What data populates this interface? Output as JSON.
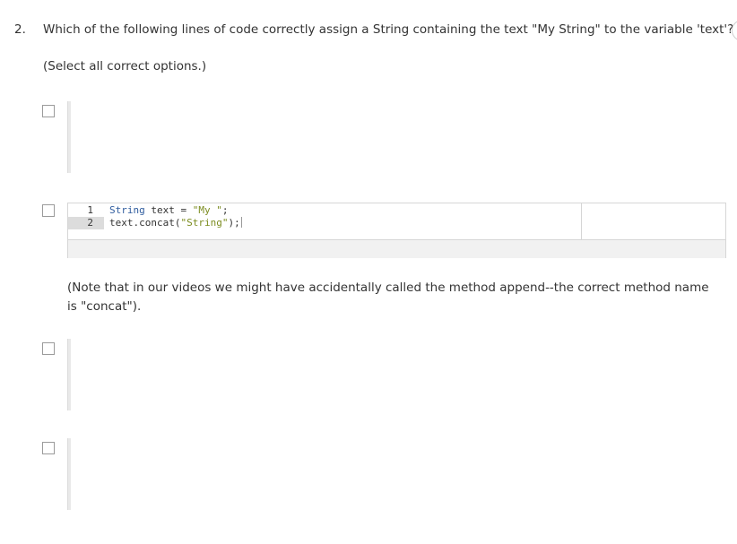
{
  "question": {
    "number": "2.",
    "text": "Which of the following lines of code correctly assign a String containing the text \"My String\" to the variable 'text'?",
    "instruction": "(Select all correct options.)"
  },
  "options": [
    {
      "checked": false
    },
    {
      "checked": false,
      "code_lines": [
        {
          "number": "1",
          "tokens": [
            {
              "type": "kw",
              "text": "String"
            },
            {
              "type": "plain",
              "text": " text "
            },
            {
              "type": "op",
              "text": "="
            },
            {
              "type": "plain",
              "text": " "
            },
            {
              "type": "str",
              "text": "\"My \""
            },
            {
              "type": "plain",
              "text": ";"
            }
          ]
        },
        {
          "number": "2",
          "tokens": [
            {
              "type": "plain",
              "text": "text.concat("
            },
            {
              "type": "str",
              "text": "\"String\""
            },
            {
              "type": "plain",
              "text": ");"
            }
          ]
        }
      ],
      "note": "(Note that in our videos we might have accidentally called the method append--the correct method name is \"concat\")."
    },
    {
      "checked": false
    },
    {
      "checked": false
    }
  ],
  "colors": {
    "keyword": "#2f5c9e",
    "string": "#7b8c1f",
    "text": "#333333"
  }
}
